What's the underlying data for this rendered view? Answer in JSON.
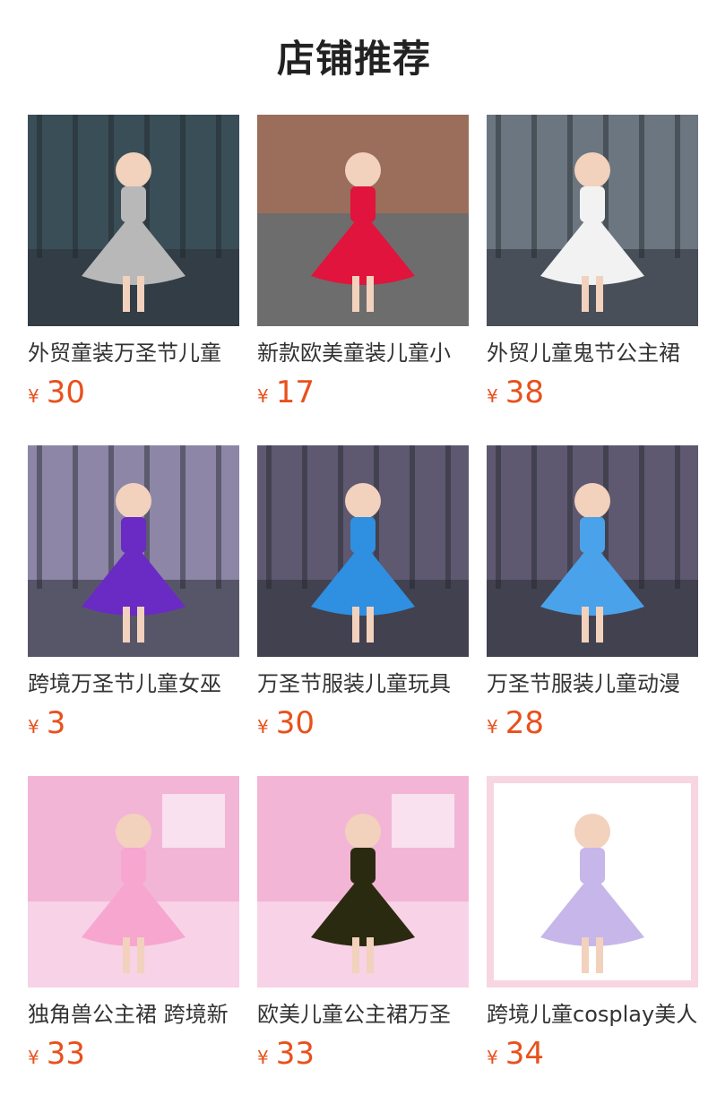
{
  "section_title": "店铺推荐",
  "products": [
    {
      "name": "外贸童装万圣节儿童",
      "currency": "¥",
      "price": "30",
      "bg": "#3a4e58",
      "dress": "#b8b8b8",
      "scene": "night"
    },
    {
      "name": "新款欧美童装儿童小",
      "currency": "¥",
      "price": "17",
      "bg": "#8a7e7a",
      "dress": "#e0143c",
      "scene": "street"
    },
    {
      "name": "外贸儿童鬼节公主裙",
      "currency": "¥",
      "price": "38",
      "bg": "#6b7680",
      "dress": "#f2f2f2",
      "scene": "night"
    },
    {
      "name": "跨境万圣节儿童女巫",
      "currency": "¥",
      "price": "3",
      "bg": "#8d86a6",
      "dress": "#6a2bc4",
      "scene": "forest"
    },
    {
      "name": "万圣节服装儿童玩具",
      "currency": "¥",
      "price": "30",
      "bg": "#5e5870",
      "dress": "#2f8fe0",
      "scene": "forest"
    },
    {
      "name": "万圣节服装儿童动漫",
      "currency": "¥",
      "price": "28",
      "bg": "#5e5870",
      "dress": "#4aa3ea",
      "scene": "forest"
    },
    {
      "name": "独角兽公主裙 跨境新",
      "currency": "¥",
      "price": "33",
      "bg": "#f3b5d6",
      "dress": "#f7a6d0",
      "scene": "pink"
    },
    {
      "name": "欧美儿童公主裙万圣",
      "currency": "¥",
      "price": "33",
      "bg": "#f3b5d6",
      "dress": "#2a2a10",
      "scene": "pink"
    },
    {
      "name": "跨境儿童cosplay美人",
      "currency": "¥",
      "price": "34",
      "bg": "#f7d6e2",
      "dress": "#c7b6ea",
      "scene": "frame"
    }
  ]
}
